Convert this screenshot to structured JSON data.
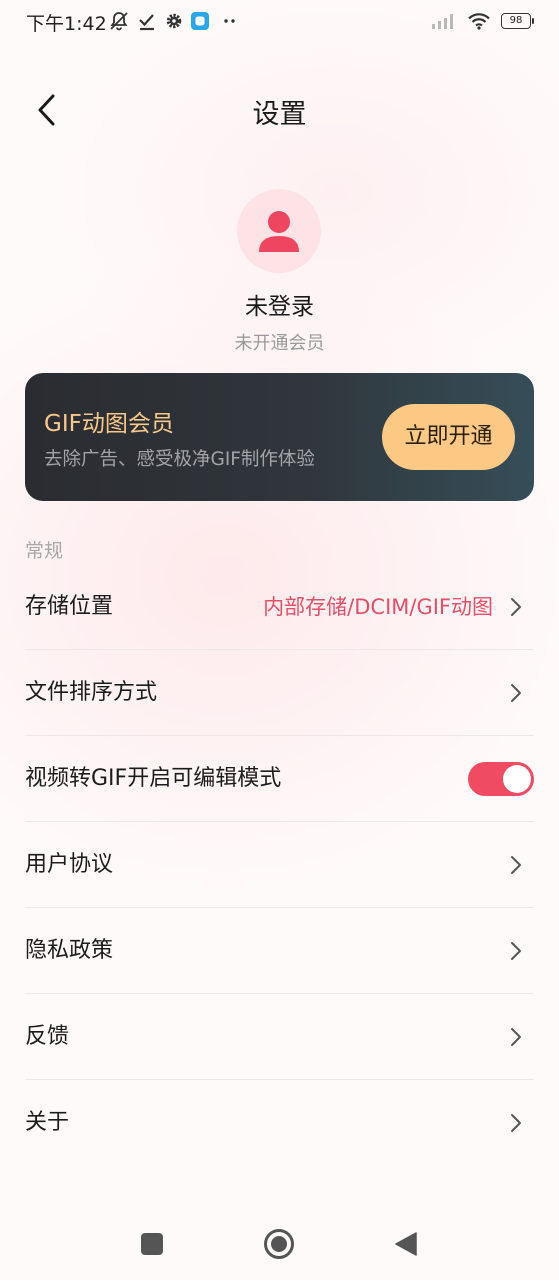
{
  "status_bar": {
    "time": "下午1:42",
    "battery": "98",
    "icons": [
      "mute-bell-icon",
      "check-icon",
      "gear-icon",
      "app-notification-icon",
      "more-dots-icon",
      "signal-icon",
      "wifi-icon",
      "battery-icon"
    ]
  },
  "header": {
    "title": "设置",
    "back_icon": "chevron-left-icon"
  },
  "profile": {
    "avatar_icon": "user-icon",
    "name": "未登录",
    "subtitle": "未开通会员"
  },
  "vip_card": {
    "title": "GIF动图会员",
    "description": "去除广告、感受极净GIF制作体验",
    "button_label": "立即开通"
  },
  "settings": {
    "section_title": "常规",
    "items": [
      {
        "label": "存储位置",
        "value": "内部存储/DCIM/GIF动图"
      },
      {
        "label": "文件排序方式"
      },
      {
        "label": "视频转GIF开启可编辑模式",
        "toggle_on": true
      },
      {
        "label": "用户协议"
      },
      {
        "label": "隐私政策"
      },
      {
        "label": "反馈"
      },
      {
        "label": "关于"
      }
    ]
  },
  "nav_bar": {
    "buttons": [
      "recents-square-icon",
      "home-circle-icon",
      "back-triangle-icon"
    ]
  },
  "colors": {
    "accent": "#ef4b63",
    "vip_gold": "#fcc985",
    "vip_card_dark": "#2a2c31",
    "value_text": "#e05068"
  }
}
